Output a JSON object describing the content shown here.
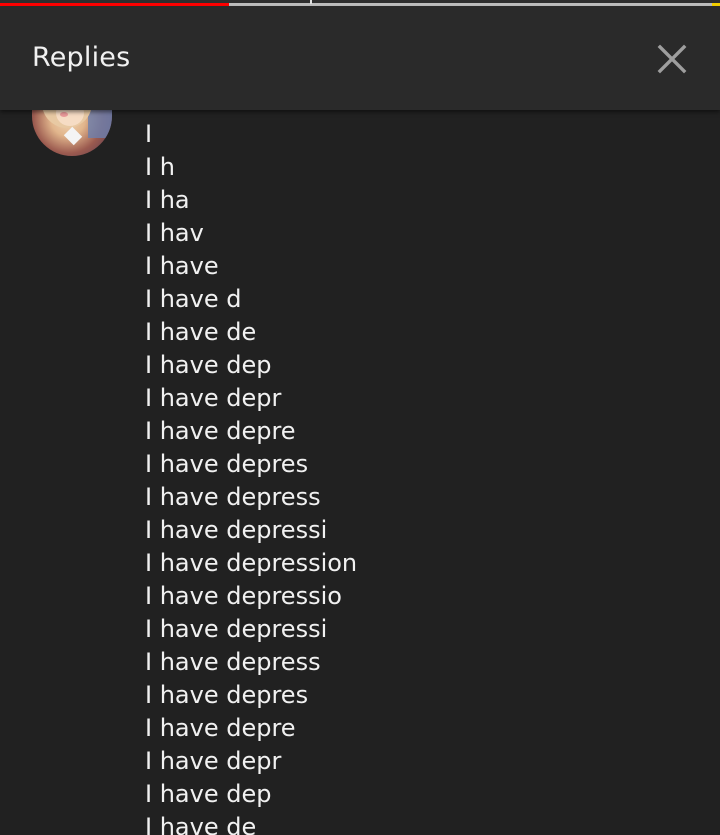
{
  "video_progress": {
    "played_fraction": 0.318,
    "colors": {
      "played": "#ff0000",
      "buffer": "#bdbdbd",
      "ad_marker": "#f4d000"
    }
  },
  "header": {
    "title": "Replies",
    "close_icon": "close-icon"
  },
  "comment": {
    "avatar_icon": "avatar",
    "lines": [
      "I",
      "I h",
      "I ha",
      "I hav",
      "I have",
      "I have d",
      "I have de",
      "I have dep",
      "I have depr",
      "I have depre",
      "I have depres",
      "I have depress",
      "I have depressi",
      "I have depression",
      "I have depressio",
      "I have depressi",
      "I have depress",
      "I have depres",
      "I have depre",
      "I have depr",
      "I have dep",
      "I have de"
    ]
  }
}
